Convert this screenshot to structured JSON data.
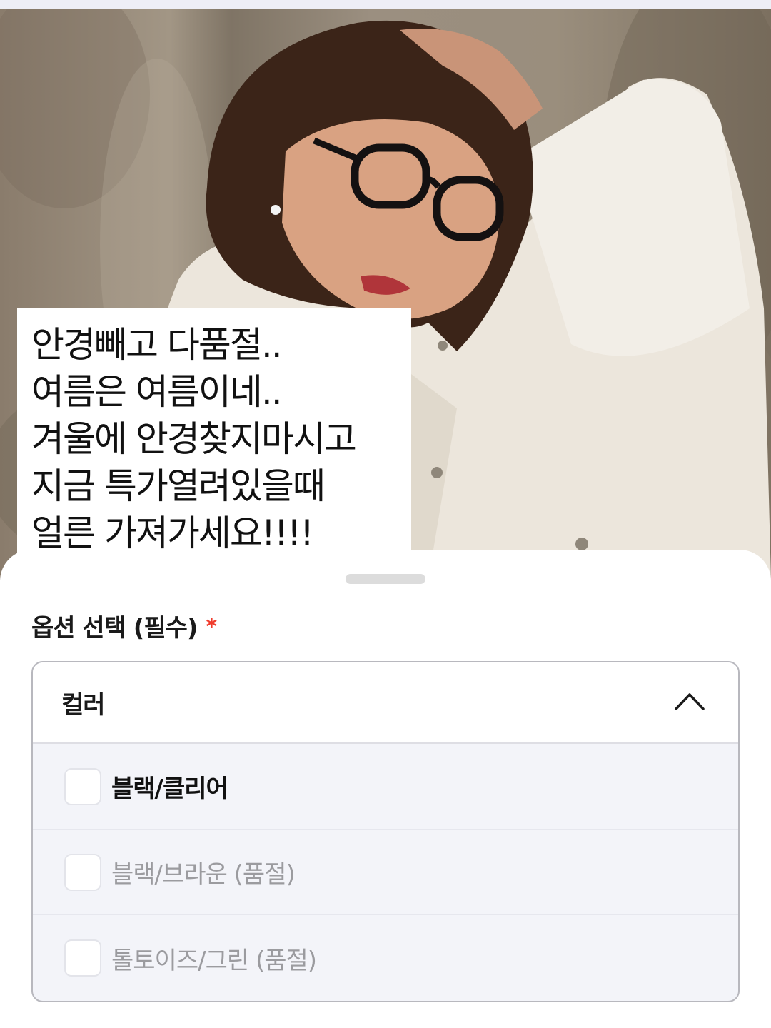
{
  "post": {
    "caption_lines": [
      "안경빼고 다품절..",
      "여름은 여름이네..",
      "겨울에 안경찾지마시고",
      "지금 특가열려있을때",
      "얼른 가져가세요!!!!"
    ]
  },
  "option_sheet": {
    "title": "옵션 선택 (필수)",
    "required_mark": "*",
    "dropdown": {
      "label": "컬러",
      "expanded": true,
      "options": [
        {
          "label": "블랙/클리어",
          "sold_out": false,
          "checked": false
        },
        {
          "label": "블랙/브라운 (품절)",
          "sold_out": true,
          "checked": false
        },
        {
          "label": "톨토이즈/그린 (품절)",
          "sold_out": true,
          "checked": false
        }
      ]
    }
  },
  "colors": {
    "required_accent": "#f03c2d",
    "sheet_background": "#ffffff",
    "options_background": "#f3f4f9",
    "disabled_text": "#9b9b9f"
  },
  "icons": {
    "collapse": "chevron-up-icon",
    "handle": "drag-handle"
  }
}
